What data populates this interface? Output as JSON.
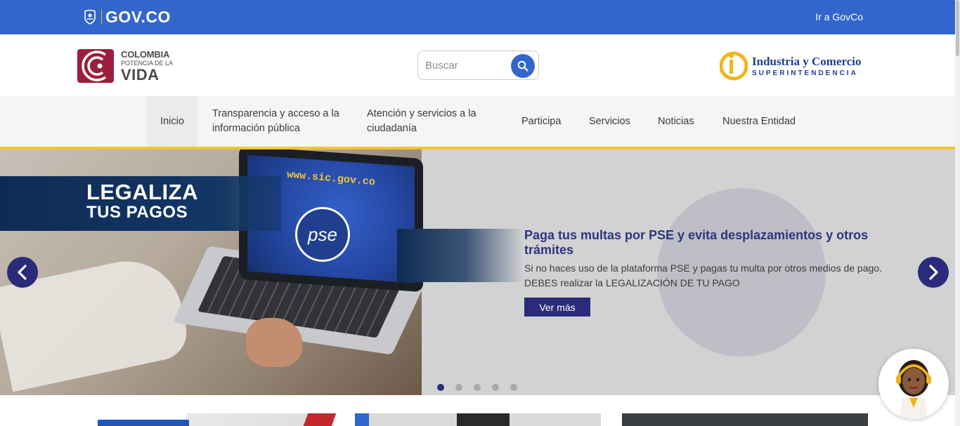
{
  "govbar": {
    "logo_text": "GOV.CO",
    "link": "Ir a GovCo",
    "color": "#3366cc"
  },
  "header": {
    "left_logo": {
      "line1": "COLOMBIA",
      "line2": "POTENCIA DE LA",
      "line3": "VIDA"
    },
    "search": {
      "placeholder": "Buscar",
      "icon": "search-icon"
    },
    "right_logo": {
      "line1": "Industria y Comercio",
      "line2": "SUPERINTENDENCIA"
    }
  },
  "nav": {
    "items": [
      {
        "label": "Inicio"
      },
      {
        "label": "Transparencia y acceso a la información pública"
      },
      {
        "label": "Atención y servicios a la ciudadanía"
      },
      {
        "label": "Participa"
      },
      {
        "label": "Servicios"
      },
      {
        "label": "Noticias"
      },
      {
        "label": "Nuestra Entidad"
      }
    ],
    "active": "Inicio",
    "accent": "#f3c52f"
  },
  "banner": {
    "image_text": {
      "line1": "LEGALIZA",
      "line2": "TUS PAGOS",
      "url": "www.sic.gov.co",
      "pse": "pse"
    },
    "title": "Paga tus multas por PSE y evita desplazamientos y otros trámites",
    "text": "Si no haces uso de la plataforma PSE y pagas tu multa por otros medios de pago. DEBES realizar la LEGALIZACIÓN DE TU PAGO",
    "button": "Ver más",
    "prev_icon": "chevron-left-icon",
    "next_icon": "chevron-right-icon",
    "slides_total": 5,
    "slide_active": 1,
    "primary": "#2a2b7a"
  }
}
